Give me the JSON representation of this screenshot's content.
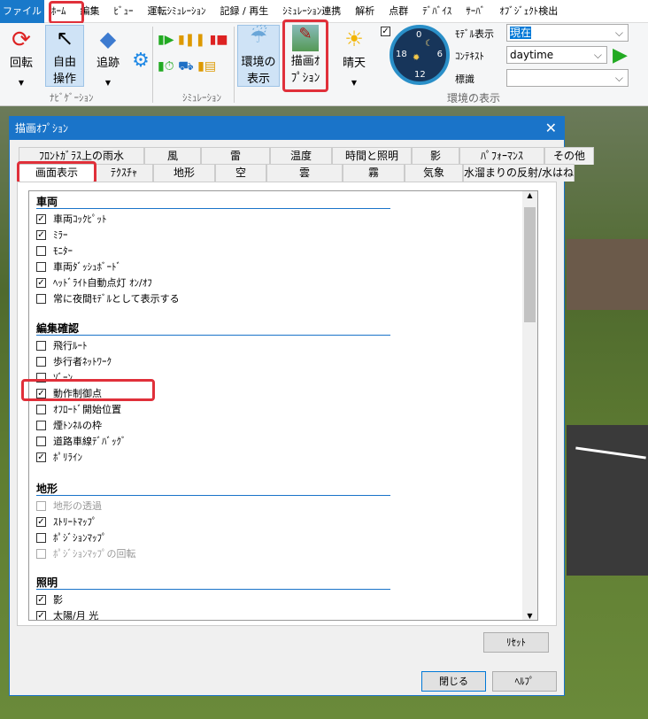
{
  "menu": [
    "ファイル",
    "ﾎｰﾑ",
    "編集",
    "ﾋﾞｭｰ",
    "運転ｼﾐｭﾚｰｼｮﾝ",
    "記録 / 再生",
    "ｼﾐｭﾚｰｼｮﾝ連携",
    "解析",
    "点群",
    "ﾃﾞﾊﾞｲｽ",
    "ｻｰﾊﾞ",
    "ｵﾌﾞｼﾞｪｸﾄ検出"
  ],
  "ribbon": {
    "rotate": "回転",
    "free": "自由操作",
    "track": "追跡",
    "env": "環境の表示",
    "draw": "描画ｵﾌﾟｼｮﾝ",
    "weather": "晴天",
    "group_nav": "ﾅﾋﾞｹﾞｰｼｮﾝ",
    "group_sim": "ｼﾐｭﾚｰｼｮﾝ",
    "group_env": "環境の表示",
    "model_label": "ﾓﾃﾞﾙ表示",
    "model_value": "現在",
    "context_label": "ｺﾝﾃｷｽﾄ",
    "context_value": "daytime",
    "sign_label": "標識",
    "sign_value": "",
    "clock": [
      "0",
      "6",
      "12",
      "18"
    ]
  },
  "dialog": {
    "title": "描画ｵﾌﾟｼｮﾝ",
    "tabs_row1": [
      "ﾌﾛﾝﾄｶﾞﾗｽ上の雨水",
      "風",
      "雷",
      "温度",
      "時間と照明",
      "影",
      "ﾊﾟﾌｫｰﾏﾝｽ",
      "その他"
    ],
    "tabs_row2": [
      "画面表示",
      "ﾃｸｽﾁｬ",
      "地形",
      "空",
      "雲",
      "霧",
      "気象",
      "水溜まりの反射/水はね"
    ],
    "groups": [
      {
        "title": "車両",
        "items": [
          {
            "label": "車両ｺｯｸﾋﾟｯﾄ",
            "checked": true
          },
          {
            "label": "ﾐﾗｰ",
            "checked": true
          },
          {
            "label": "ﾓﾆﾀｰ",
            "checked": false
          },
          {
            "label": "車両ﾀﾞｯｼｭﾎﾞｰﾄﾞ",
            "checked": false
          },
          {
            "label": "ﾍｯﾄﾞﾗｲﾄ自動点灯 ｵﾝ/ｵﾌ",
            "checked": true
          },
          {
            "label": "常に夜間ﾓﾃﾞﾙとして表示する",
            "checked": false
          }
        ]
      },
      {
        "title": "編集確認",
        "items": [
          {
            "label": "飛行ﾙｰﾄ",
            "checked": false
          },
          {
            "label": "歩行者ﾈｯﾄﾜｰｸ",
            "checked": false
          },
          {
            "label": "ｿﾞｰﾝ",
            "checked": false
          },
          {
            "label": "動作制御点",
            "checked": true
          },
          {
            "label": "ｵﾌﾛｰﾄﾞ開始位置",
            "checked": false
          },
          {
            "label": "煙ﾄﾝﾈﾙの枠",
            "checked": false
          },
          {
            "label": "道路車線ﾃﾞﾊﾞｯｸﾞ",
            "checked": false
          },
          {
            "label": "ﾎﾟﾘﾗｲﾝ",
            "checked": true
          }
        ]
      },
      {
        "title": "地形",
        "items": [
          {
            "label": "地形の透過",
            "checked": false,
            "disabled": true
          },
          {
            "label": "ｽﾄﾘｰﾄﾏｯﾌﾟ",
            "checked": true
          },
          {
            "label": "ﾎﾟｼﾞｼｮﾝﾏｯﾌﾟ",
            "checked": false
          },
          {
            "label": "ﾎﾟｼﾞｼｮﾝﾏｯﾌﾟの回転",
            "checked": false,
            "disabled": true
          }
        ]
      },
      {
        "title": "照明",
        "items": [
          {
            "label": "影",
            "checked": true
          },
          {
            "label": "太陽/月 光",
            "checked": true
          }
        ]
      }
    ],
    "reset": "ﾘｾｯﾄ",
    "close": "閉じる",
    "help": "ﾍﾙﾌﾟ"
  },
  "colors": {
    "accent": "#1a74c9",
    "highlight": "#e0303a"
  }
}
